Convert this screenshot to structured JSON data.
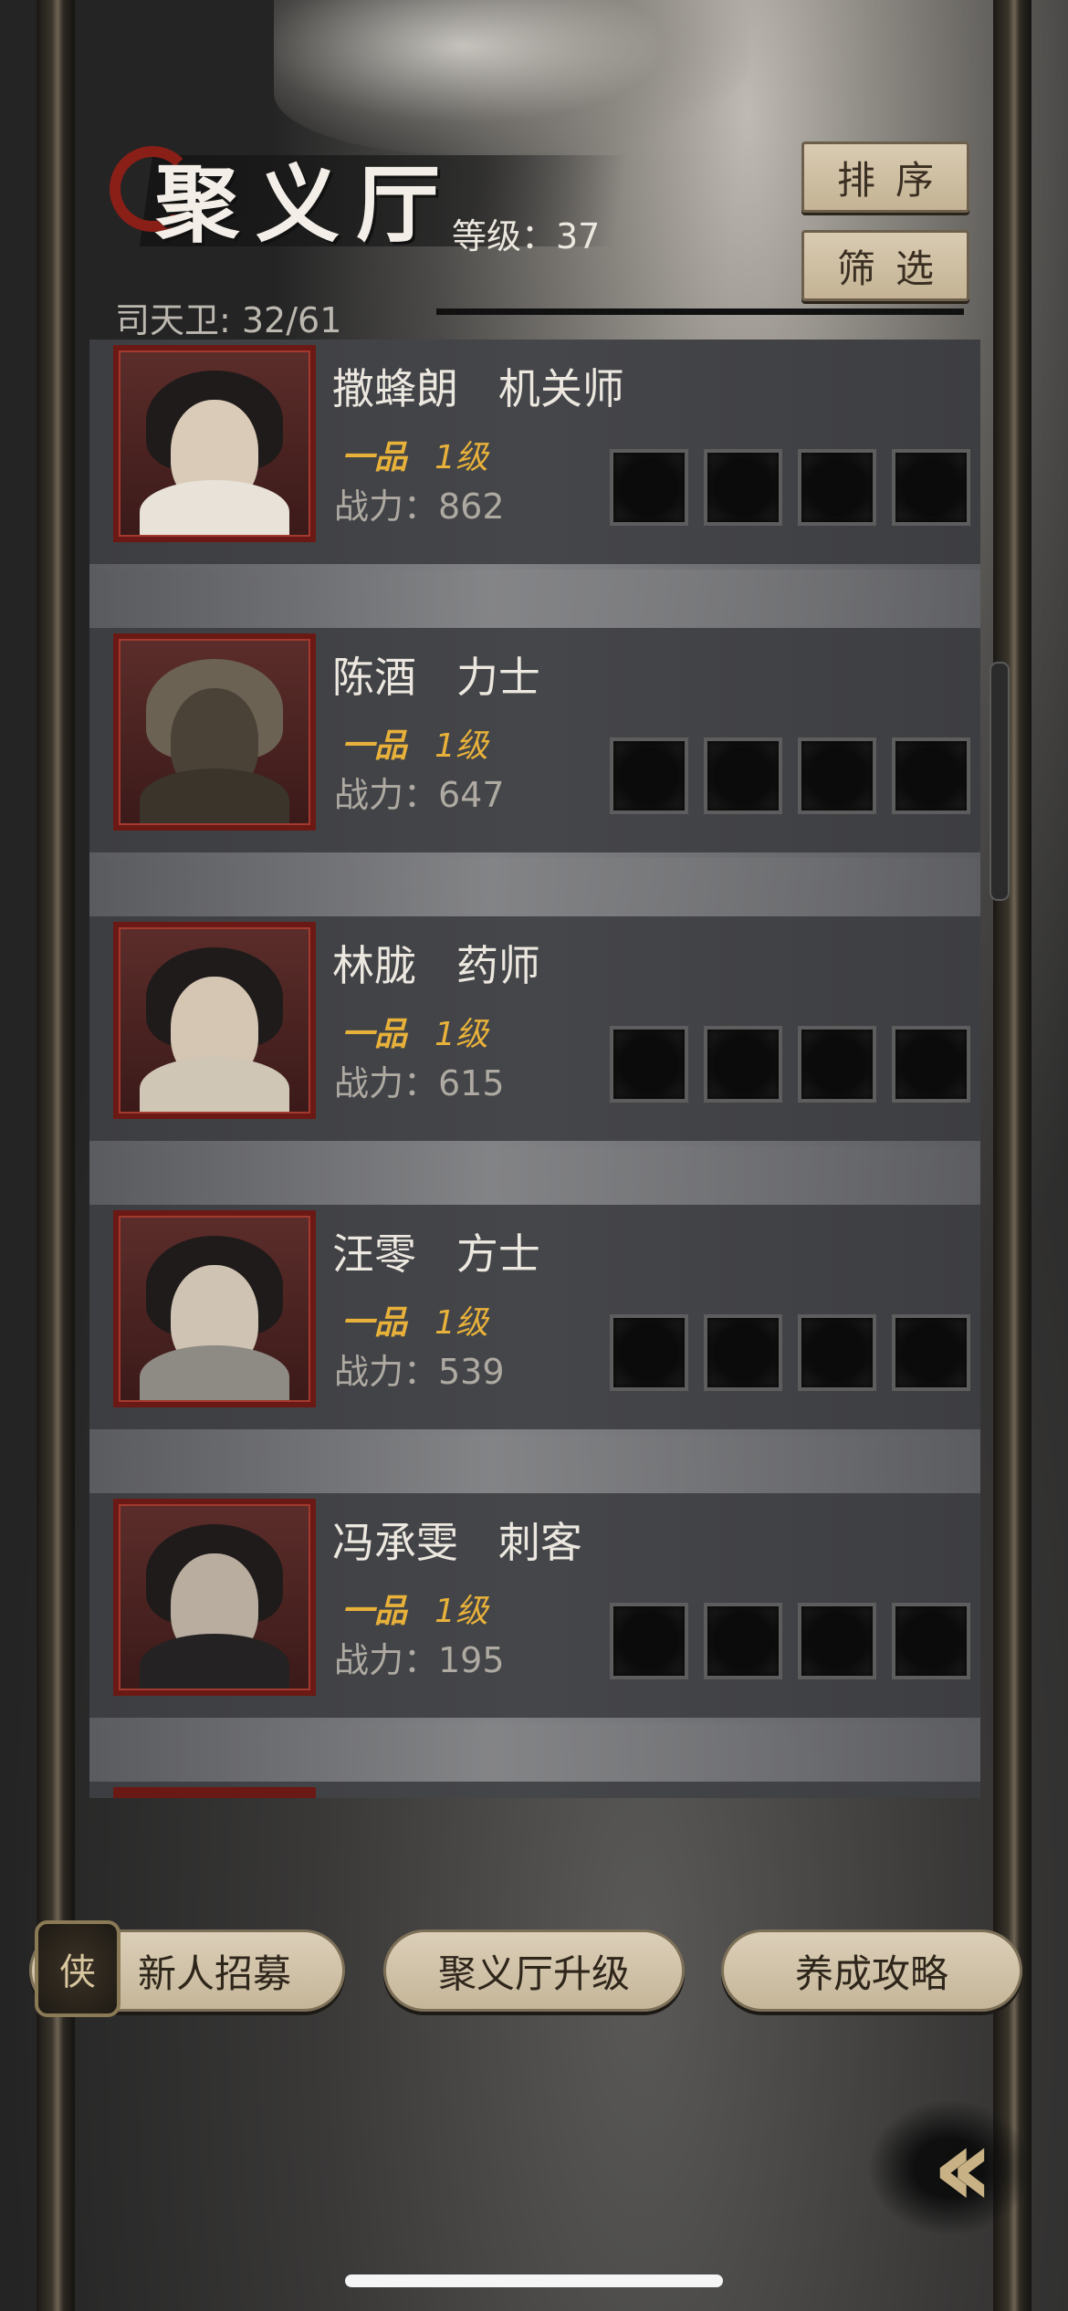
{
  "header": {
    "title": "聚义厅",
    "level_text": "等级：37",
    "guard_count": "司天卫: 32/61"
  },
  "buttons": {
    "sort": "排序",
    "filter": "筛选"
  },
  "heroes": [
    {
      "name_line": "撒蜂朗   机关师",
      "grade": "一品",
      "level": "1级",
      "power": "战力：862"
    },
    {
      "name_line": "陈酒   力士",
      "grade": "一品",
      "level": "1级",
      "power": "战力：647"
    },
    {
      "name_line": "林胧   药师",
      "grade": "一品",
      "level": "1级",
      "power": "战力：615"
    },
    {
      "name_line": "汪零   方士",
      "grade": "一品",
      "level": "1级",
      "power": "战力：539"
    },
    {
      "name_line": "冯承雯   刺客",
      "grade": "一品",
      "level": "1级",
      "power": "战力：195"
    }
  ],
  "bottom": {
    "recruit": "新人招募",
    "upgrade": "聚义厅升级",
    "guide": "养成攻略",
    "back_icon": "double-chevron-left-icon"
  },
  "colors": {
    "accent_gold": "#e7b13a",
    "portrait_frame": "#6b1914",
    "button_beige": "#d4c5aa"
  }
}
